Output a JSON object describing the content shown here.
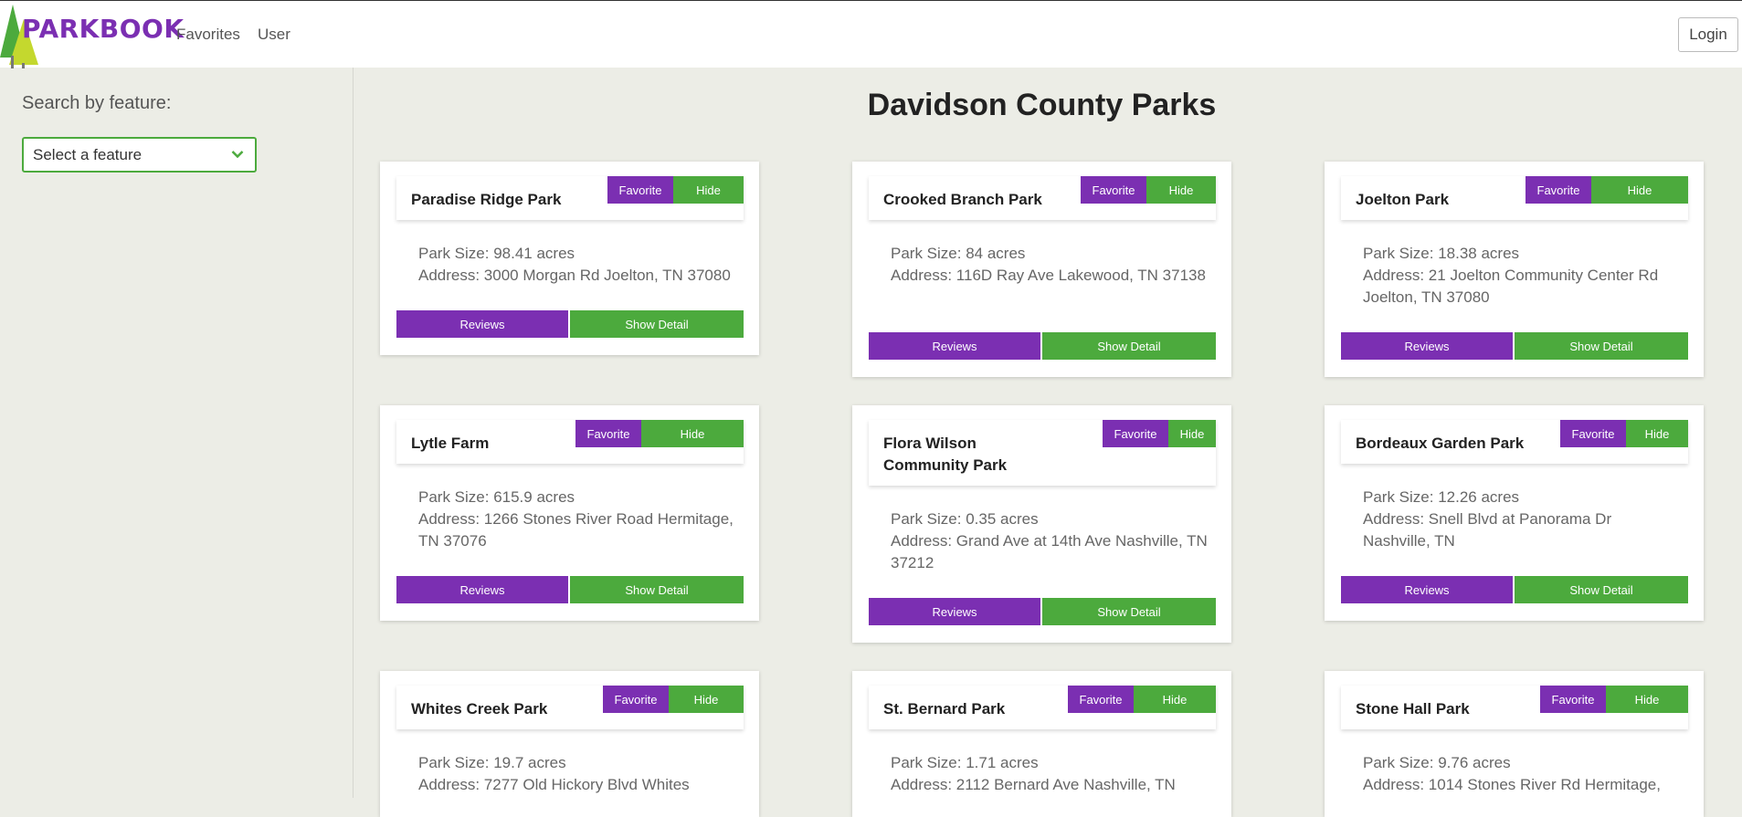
{
  "brand": {
    "logo_text": "PARKBOOK",
    "accent_purple": "#7b2fb2",
    "accent_green": "#4caa3d"
  },
  "nav": {
    "favorites": "Favorites",
    "user": "User",
    "login": "Login"
  },
  "sidebar": {
    "title": "Search by feature:",
    "select_value": "Select a feature",
    "select_icon": "chevron-down-icon"
  },
  "page_title": "Davidson County Parks",
  "buttons": {
    "favorite": "Favorite",
    "hide": "Hide",
    "reviews": "Reviews",
    "show_detail": "Show Detail"
  },
  "parks": [
    {
      "name": "Paradise Ridge Park",
      "size": "Park Size: 98.41 acres",
      "address": "Address: 3000 Morgan Rd Joelton, TN 37080"
    },
    {
      "name": "Crooked Branch Park",
      "size": "Park Size: 84 acres",
      "address": "Address: 116D Ray Ave Lakewood, TN 37138"
    },
    {
      "name": "Joelton Park",
      "size": "Park Size: 18.38 acres",
      "address": "Address: 21 Joelton Community Center Rd Joelton, TN 37080"
    },
    {
      "name": "Lytle Farm",
      "size": "Park Size: 615.9 acres",
      "address": "Address: 1266 Stones River Road Hermitage, TN 37076"
    },
    {
      "name": "Flora Wilson Community Park",
      "size": "Park Size: 0.35 acres",
      "address": "Address: Grand Ave at 14th Ave Nashville, TN 37212"
    },
    {
      "name": "Bordeaux Garden Park",
      "size": "Park Size: 12.26 acres",
      "address": "Address: Snell Blvd at Panorama Dr Nashville, TN"
    },
    {
      "name": "Whites Creek Park",
      "size": "Park Size: 19.7 acres",
      "address": "Address: 7277 Old Hickory Blvd Whites"
    },
    {
      "name": "St. Bernard Park",
      "size": "Park Size: 1.71 acres",
      "address": "Address: 2112 Bernard Ave Nashville, TN"
    },
    {
      "name": "Stone Hall Park",
      "size": "Park Size: 9.76 acres",
      "address": "Address: 1014 Stones River Rd Hermitage,"
    }
  ]
}
